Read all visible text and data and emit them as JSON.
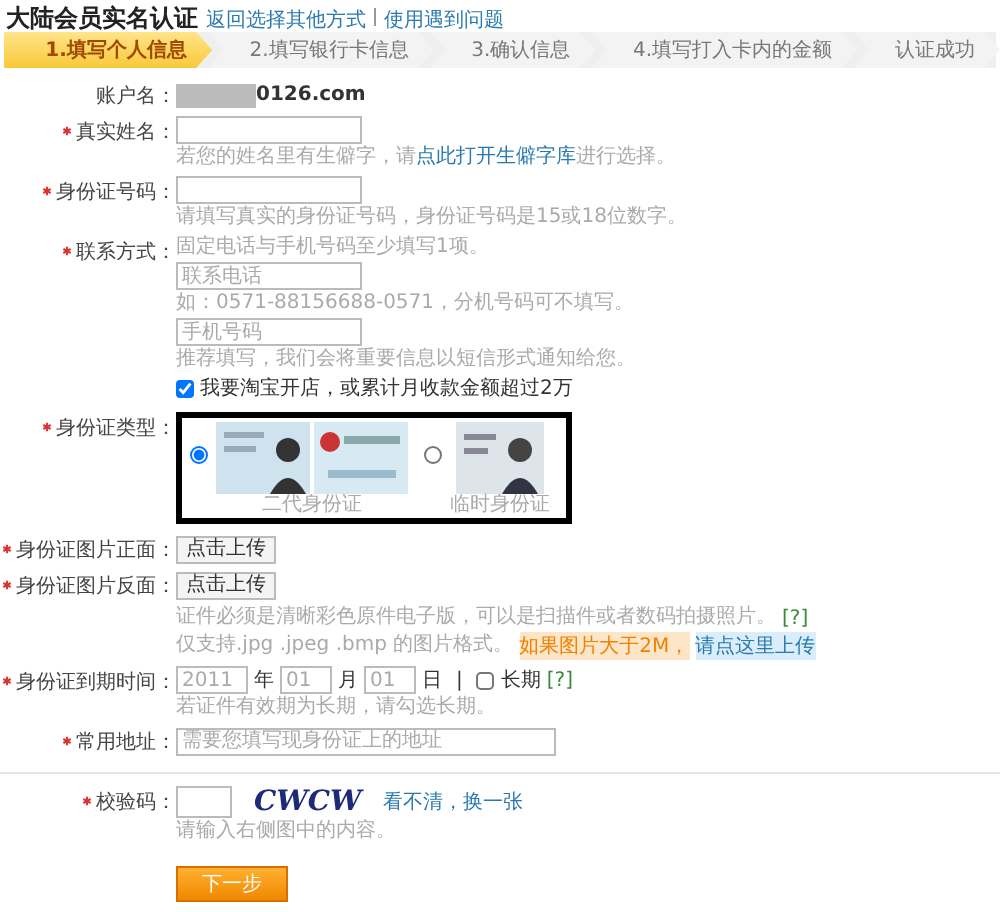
{
  "header": {
    "title": "大陆会员实名认证",
    "links": [
      "返回选择其他方式",
      "使用遇到问题"
    ]
  },
  "steps": [
    {
      "label": "1.填写个人信息",
      "selected": true
    },
    {
      "label": "2.填写银行卡信息",
      "selected": false
    },
    {
      "label": "3.确认信息",
      "selected": false
    },
    {
      "label": "4.填写打入卡内的金额",
      "selected": false
    },
    {
      "label": "认证成功",
      "selected": false
    }
  ],
  "account": {
    "label": "账户名：",
    "value": "0126.com"
  },
  "real_name": {
    "label": "真实姓名：",
    "required": true,
    "hint": "若您的姓名里有生僻字，请",
    "hint_link": "点此打开生僻字库",
    "hint_end": "进行选择。"
  },
  "id_number": {
    "label": "身份证号码：",
    "required": true,
    "hint": "请填写真实的身份证号码，身份证号码是15或18位数字。"
  },
  "contact": {
    "label": "联系方式：",
    "required": true,
    "note": "固定电话与手机号码至少填写1项。",
    "phone_placeholder": "联系电话",
    "phone_hint": "如：0571-88156688-0571，分机号码可不填写。",
    "mobile_placeholder": "手机号码",
    "mobile_hint": "推荐填写，我们会将重要信息以短信形式通知给您。"
  },
  "shop_option": {
    "label": "我要淘宝开店，或累计月收款金额超过2万",
    "checked": true
  },
  "id_type": {
    "label": "身份证类型：",
    "required": true,
    "options": [
      {
        "caption": "二代身份证",
        "selected": true
      },
      {
        "caption": "临时身份证",
        "selected": false
      }
    ]
  },
  "uploads": [
    {
      "label": "身份证图片正面：",
      "required": true,
      "button": "点击上传"
    },
    {
      "label": "身份证图片反面：",
      "required": true,
      "button": "点击上传"
    }
  ],
  "upload_hint": {
    "line1": "证件必须是清晰彩色原件电子版，可以是扫描件或者数码拍摄照片。",
    "help": "[?]",
    "line2": "仅支持.jpg .jpeg .bmp 的图片格式。",
    "warning": "如果图片大于2M，",
    "link": "请点这里上传"
  },
  "expiry": {
    "label": "身份证到期时间：",
    "required": true,
    "year": "2011",
    "year_unit": "年",
    "month": "01",
    "month_unit": "月",
    "day": "01",
    "day_unit": "日",
    "separator": "|",
    "long_term": {
      "label": "长期",
      "checked": false
    },
    "help": "[?]",
    "hint": "若证件有效期为长期，请勾选长期。"
  },
  "address": {
    "label": "常用地址：",
    "required": true,
    "placeholder": "需要您填写现身份证上的地址"
  },
  "captcha": {
    "label": "校验码：",
    "required": true,
    "code": "CWCW",
    "refresh": "看不清，换一张",
    "hint": "请输入右侧图中的内容。"
  },
  "next_button": "下一步"
}
